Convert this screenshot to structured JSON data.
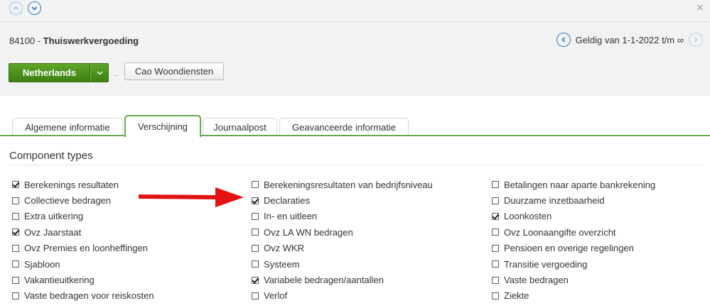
{
  "toolbar": {
    "close_label": "×"
  },
  "record": {
    "code": "84100",
    "separator": " - ",
    "name": "Thuiswerkvergoeding"
  },
  "validity": {
    "text": "Geldig van 1-1-2022 t/m ∞"
  },
  "buttons": {
    "country": "Netherlands",
    "dots": "..",
    "cao": "Cao Woondiensten"
  },
  "tabs": [
    {
      "label": "Algemene informatie",
      "active": false
    },
    {
      "label": "Verschijning",
      "active": true
    },
    {
      "label": "Journaalpost",
      "active": false
    },
    {
      "label": "Geavanceerde informatie",
      "active": false
    }
  ],
  "section": {
    "title": "Component types"
  },
  "columns": [
    [
      {
        "label": "Berekenings resultaten",
        "checked": true
      },
      {
        "label": "Collectieve bedragen",
        "checked": false
      },
      {
        "label": "Extra uitkering",
        "checked": false
      },
      {
        "label": "Ovz Jaarstaat",
        "checked": true
      },
      {
        "label": "Ovz Premies en loonheffingen",
        "checked": false
      },
      {
        "label": "Sjabloon",
        "checked": false
      },
      {
        "label": "Vakantieuitkering",
        "checked": false
      },
      {
        "label": "Vaste bedragen voor reiskosten",
        "checked": false
      }
    ],
    [
      {
        "label": "Berekeningsresultaten van bedrijfsniveau",
        "checked": false
      },
      {
        "label": "Declaraties",
        "checked": true
      },
      {
        "label": "In- en uitleen",
        "checked": false
      },
      {
        "label": "Ovz LA WN bedragen",
        "checked": false
      },
      {
        "label": "Ovz WKR",
        "checked": false
      },
      {
        "label": "Systeem",
        "checked": false
      },
      {
        "label": "Variabele bedragen/aantallen",
        "checked": true
      },
      {
        "label": "Verlof",
        "checked": false
      }
    ],
    [
      {
        "label": "Betalingen naar aparte bankrekening",
        "checked": false
      },
      {
        "label": "Duurzame inzetbaarheid",
        "checked": false
      },
      {
        "label": "Loonkosten",
        "checked": true
      },
      {
        "label": "Ovz Loonaangifte overzicht",
        "checked": false
      },
      {
        "label": "Pensioen en overige regelingen",
        "checked": false
      },
      {
        "label": "Transitie vergoeding",
        "checked": false
      },
      {
        "label": "Vaste bedragen",
        "checked": false
      },
      {
        "label": "Ziekte",
        "checked": false
      }
    ]
  ],
  "colors": {
    "accent_green": "#4e9420",
    "tab_green": "#6aa84f",
    "link_blue": "#2f7ec7",
    "arrow_red": "#e41212"
  },
  "icons": {
    "nav_up": "chevron-up-icon",
    "nav_down": "chevron-down-icon",
    "prev": "chevron-left-icon",
    "next": "chevron-right-icon",
    "caret": "caret-down-icon",
    "annotation": "red-arrow-icon"
  }
}
